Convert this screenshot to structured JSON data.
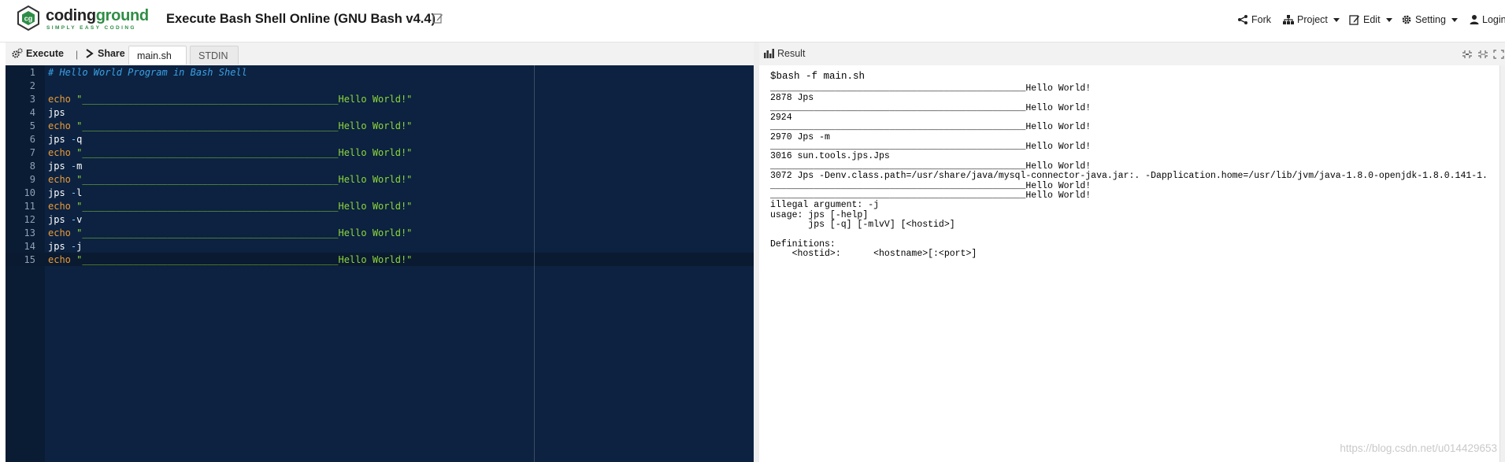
{
  "header": {
    "logo_part1": "coding",
    "logo_part2": "ground",
    "logo_tagline": "SIMPLY EASY CODING",
    "title": "Execute Bash Shell Online (GNU Bash v4.4)",
    "menu": {
      "fork": "Fork",
      "project": "Project",
      "edit": "Edit",
      "setting": "Setting",
      "login": "Login"
    }
  },
  "toolbar": {
    "execute": "Execute",
    "separator": "|",
    "share": "Share",
    "tabs": [
      "main.sh",
      "STDIN"
    ],
    "result_label": "Result"
  },
  "editor": {
    "lines": [
      {
        "n": "1",
        "segments": [
          {
            "t": "# Hello World Program in Bash Shell",
            "c": "cmt"
          }
        ]
      },
      {
        "n": "2",
        "segments": []
      },
      {
        "n": "3",
        "segments": [
          {
            "t": "echo",
            "c": "kw"
          },
          {
            "t": " \"",
            "c": "str"
          },
          {
            "t": "_____________________________________________Hello World!\"",
            "c": "str"
          }
        ]
      },
      {
        "n": "4",
        "segments": [
          {
            "t": "jps",
            "c": "cmd"
          }
        ]
      },
      {
        "n": "5",
        "segments": [
          {
            "t": "echo",
            "c": "kw"
          },
          {
            "t": " \"",
            "c": "str"
          },
          {
            "t": "_____________________________________________Hello World!\"",
            "c": "str"
          }
        ]
      },
      {
        "n": "6",
        "segments": [
          {
            "t": "jps",
            "c": "cmd"
          },
          {
            "t": " -",
            "c": "opt"
          },
          {
            "t": "q",
            "c": "cmd"
          }
        ]
      },
      {
        "n": "7",
        "segments": [
          {
            "t": "echo",
            "c": "kw"
          },
          {
            "t": " \"",
            "c": "str"
          },
          {
            "t": "_____________________________________________Hello World!\"",
            "c": "str"
          }
        ]
      },
      {
        "n": "8",
        "segments": [
          {
            "t": "jps",
            "c": "cmd"
          },
          {
            "t": " -",
            "c": "opt"
          },
          {
            "t": "m",
            "c": "cmd"
          }
        ]
      },
      {
        "n": "9",
        "segments": [
          {
            "t": "echo",
            "c": "kw"
          },
          {
            "t": " \"",
            "c": "str"
          },
          {
            "t": "_____________________________________________Hello World!\"",
            "c": "str"
          }
        ]
      },
      {
        "n": "10",
        "segments": [
          {
            "t": "jps",
            "c": "cmd"
          },
          {
            "t": " -",
            "c": "opt"
          },
          {
            "t": "l",
            "c": "cmd"
          }
        ]
      },
      {
        "n": "11",
        "segments": [
          {
            "t": "echo",
            "c": "kw"
          },
          {
            "t": " \"",
            "c": "str"
          },
          {
            "t": "_____________________________________________Hello World!\"",
            "c": "str"
          }
        ]
      },
      {
        "n": "12",
        "segments": [
          {
            "t": "jps",
            "c": "cmd"
          },
          {
            "t": " -",
            "c": "opt"
          },
          {
            "t": "v",
            "c": "cmd"
          }
        ]
      },
      {
        "n": "13",
        "segments": [
          {
            "t": "echo",
            "c": "kw"
          },
          {
            "t": " \"",
            "c": "str"
          },
          {
            "t": "_____________________________________________Hello World!\"",
            "c": "str"
          }
        ]
      },
      {
        "n": "14",
        "segments": [
          {
            "t": "jps",
            "c": "cmd"
          },
          {
            "t": " -",
            "c": "opt"
          },
          {
            "t": "j",
            "c": "cmd"
          }
        ]
      },
      {
        "n": "15",
        "segments": [
          {
            "t": "echo",
            "c": "kw"
          },
          {
            "t": " \"",
            "c": "str"
          },
          {
            "t": "_____________________________________________Hello World!\"",
            "c": "str"
          }
        ]
      }
    ]
  },
  "result": {
    "prompt": "$bash -f main.sh",
    "lines": [
      "_______________________________________________Hello World!",
      "2878 Jps",
      "_______________________________________________Hello World!",
      "2924",
      "_______________________________________________Hello World!",
      "2970 Jps -m",
      "_______________________________________________Hello World!",
      "3016 sun.tools.jps.Jps",
      "_______________________________________________Hello World!",
      "3072 Jps -Denv.class.path=/usr/share/java/mysql-connector-java.jar:. -Dapplication.home=/usr/lib/jvm/java-1.8.0-openjdk-1.8.0.141-1.",
      "_______________________________________________Hello World!",
      "_______________________________________________Hello World!",
      "illegal argument: -j",
      "usage: jps [-help]",
      "       jps [-q] [-mlvV] [<hostid>]",
      "",
      "Definitions:",
      "    <hostid>:      <hostname>[:<port>]"
    ]
  },
  "watermark": "https://blog.csdn.net/u014429653"
}
